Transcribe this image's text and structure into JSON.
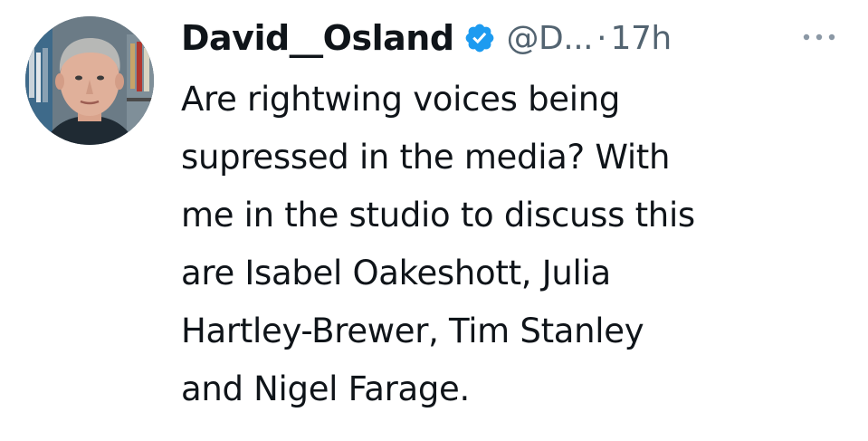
{
  "author": {
    "display_name": "David__Osland",
    "handle": "@D...",
    "separator": "·",
    "timestamp": "17h",
    "verified_icon": "verified-badge-icon",
    "avatar_icon": "avatar-photo"
  },
  "tweet": {
    "lines": [
      "Are rightwing voices being",
      "supressed in the media? With",
      "me in the studio to discuss this",
      "are Isabel Oakeshott, Julia",
      "Hartley-Brewer, Tim Stanley",
      "and Nigel Farage."
    ]
  },
  "menu": {
    "icon": "more-options-icon"
  },
  "colors": {
    "text_primary": "#0f1419",
    "text_secondary": "#536471",
    "verified_blue": "#1d9bf0",
    "background": "#ffffff"
  }
}
